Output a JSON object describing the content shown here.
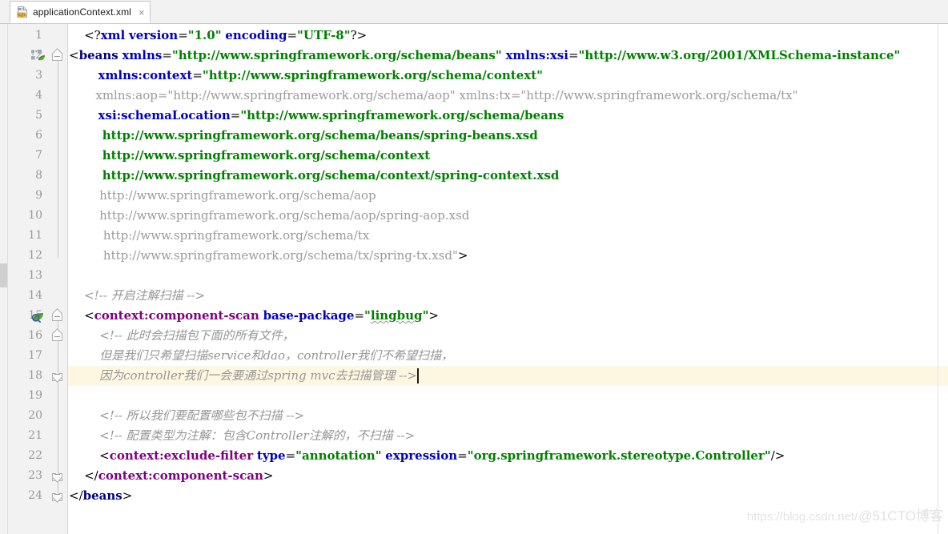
{
  "tab": {
    "label": "applicationContext.xml",
    "icon": "xml-file-icon",
    "close_label": "×"
  },
  "editor": {
    "current_line": 18,
    "caret_line": 18,
    "line_height_px": 25,
    "colors": {
      "tag": "#000080",
      "namespace_tag": "#800080",
      "attribute": "#0000c0",
      "value": "#008000",
      "comment": "#969696",
      "dimmed": "#9a9a9a",
      "current_line_bg": "#fdf7e2",
      "gutter_bg": "#f2f2f2",
      "editor_bg": "#ffffff",
      "line_number": "#999999"
    },
    "gutter_icons": [
      {
        "line": 2,
        "name": "spring-bean-gutter-icon"
      },
      {
        "line": 15,
        "name": "spring-component-scan-gutter-icon"
      }
    ],
    "lines": [
      {
        "n": 1,
        "segments": [
          {
            "t": "punct",
            "s": "    <?"
          },
          {
            "t": "attr",
            "s": "xml"
          },
          {
            "t": "plain",
            "s": " "
          },
          {
            "t": "attr",
            "s": "version"
          },
          {
            "t": "eq",
            "s": "="
          },
          {
            "t": "val",
            "s": "\"1.0\""
          },
          {
            "t": "plain",
            "s": " "
          },
          {
            "t": "attr",
            "s": "encoding"
          },
          {
            "t": "eq",
            "s": "="
          },
          {
            "t": "val",
            "s": "\"UTF-8\""
          },
          {
            "t": "punct",
            "s": "?>"
          }
        ]
      },
      {
        "n": 2,
        "segments": [
          {
            "t": "punct",
            "s": "<"
          },
          {
            "t": "tag",
            "s": "beans"
          },
          {
            "t": "plain",
            "s": " "
          },
          {
            "t": "attr",
            "s": "xmlns"
          },
          {
            "t": "eq",
            "s": "="
          },
          {
            "t": "val",
            "s": "\"http://www.springframework.org/schema/beans\""
          },
          {
            "t": "plain",
            "s": " "
          },
          {
            "t": "attr",
            "s": "xmlns:xsi"
          },
          {
            "t": "eq",
            "s": "="
          },
          {
            "t": "val",
            "s": "\"http://www.w3.org/2001/XMLSchema-instance\""
          }
        ]
      },
      {
        "n": 3,
        "segments": [
          {
            "t": "attr",
            "s": "       xmlns:context"
          },
          {
            "t": "eq",
            "s": "="
          },
          {
            "t": "val",
            "s": "\"http://www.springframework.org/schema/context\""
          }
        ]
      },
      {
        "n": 4,
        "segments": [
          {
            "t": "dim",
            "s": "       xmlns:aop=\"http://www.springframework.org/schema/aop\" xmlns:tx=\"http://www.springframework.org/schema/tx\""
          }
        ]
      },
      {
        "n": 5,
        "segments": [
          {
            "t": "attr",
            "s": "       xsi:schemaLocation"
          },
          {
            "t": "eq",
            "s": "="
          },
          {
            "t": "val",
            "s": "\"http://www.springframework.org/schema/beans"
          }
        ]
      },
      {
        "n": 6,
        "segments": [
          {
            "t": "val",
            "s": "        http://www.springframework.org/schema/beans/spring-beans.xsd"
          }
        ]
      },
      {
        "n": 7,
        "segments": [
          {
            "t": "val",
            "s": "        http://www.springframework.org/schema/context"
          }
        ]
      },
      {
        "n": 8,
        "segments": [
          {
            "t": "val",
            "s": "        http://www.springframework.org/schema/context/spring-context.xsd"
          }
        ]
      },
      {
        "n": 9,
        "segments": [
          {
            "t": "dim",
            "s": "        http://www.springframework.org/schema/aop"
          }
        ]
      },
      {
        "n": 10,
        "segments": [
          {
            "t": "dim",
            "s": "        http://www.springframework.org/schema/aop/spring-aop.xsd"
          }
        ]
      },
      {
        "n": 11,
        "segments": [
          {
            "t": "dim",
            "s": "         http://www.springframework.org/schema/tx"
          }
        ]
      },
      {
        "n": 12,
        "segments": [
          {
            "t": "dim",
            "s": "         http://www.springframework.org/schema/tx/spring-tx.xsd\""
          },
          {
            "t": "punct",
            "s": ">"
          }
        ]
      },
      {
        "n": 13,
        "segments": []
      },
      {
        "n": 14,
        "segments": [
          {
            "t": "comment",
            "s": "    <!-- 开启注解扫描 -->"
          }
        ]
      },
      {
        "n": 15,
        "segments": [
          {
            "t": "punct",
            "s": "    <"
          },
          {
            "t": "ns",
            "s": "context:component-scan"
          },
          {
            "t": "plain",
            "s": " "
          },
          {
            "t": "attr",
            "s": "base-package"
          },
          {
            "t": "eq",
            "s": "="
          },
          {
            "t": "val",
            "s": "\""
          },
          {
            "t": "val-squiggle",
            "s": "lingbug"
          },
          {
            "t": "val",
            "s": "\""
          },
          {
            "t": "punct",
            "s": ">"
          }
        ]
      },
      {
        "n": 16,
        "segments": [
          {
            "t": "comment",
            "s": "        <!-- 此时会扫描包下面的所有文件，"
          }
        ]
      },
      {
        "n": 17,
        "segments": [
          {
            "t": "comment",
            "s": "        但是我们只希望扫描service和dao，controller我们不希望扫描，"
          }
        ]
      },
      {
        "n": 18,
        "segments": [
          {
            "t": "comment",
            "s": "        因为controller我们一会要通过spring mvc去扫描管理 -->"
          }
        ]
      },
      {
        "n": 19,
        "segments": []
      },
      {
        "n": 20,
        "segments": [
          {
            "t": "comment",
            "s": "        <!-- 所以我们要配置哪些包不扫描 -->"
          }
        ]
      },
      {
        "n": 21,
        "segments": [
          {
            "t": "comment",
            "s": "        <!-- 配置类型为注解：包含Controller注解的，不扫描 -->"
          }
        ]
      },
      {
        "n": 22,
        "segments": [
          {
            "t": "punct",
            "s": "        <"
          },
          {
            "t": "ns",
            "s": "context:exclude-filter"
          },
          {
            "t": "plain",
            "s": " "
          },
          {
            "t": "attr",
            "s": "type"
          },
          {
            "t": "eq",
            "s": "="
          },
          {
            "t": "val",
            "s": "\"annotation\""
          },
          {
            "t": "plain",
            "s": " "
          },
          {
            "t": "attr",
            "s": "expression"
          },
          {
            "t": "eq",
            "s": "="
          },
          {
            "t": "val",
            "s": "\"org.springframework.stereotype.Controller\""
          },
          {
            "t": "punct",
            "s": "/>"
          }
        ]
      },
      {
        "n": 23,
        "segments": [
          {
            "t": "punct",
            "s": "    </"
          },
          {
            "t": "ns",
            "s": "context:component-scan"
          },
          {
            "t": "punct",
            "s": ">"
          }
        ]
      },
      {
        "n": 24,
        "segments": [
          {
            "t": "punct",
            "s": "</"
          },
          {
            "t": "tag",
            "s": "beans"
          },
          {
            "t": "punct",
            "s": ">"
          }
        ]
      }
    ]
  },
  "watermark": {
    "url": "https://blog.csdn.net/",
    "handle": "@51CTO博客"
  }
}
